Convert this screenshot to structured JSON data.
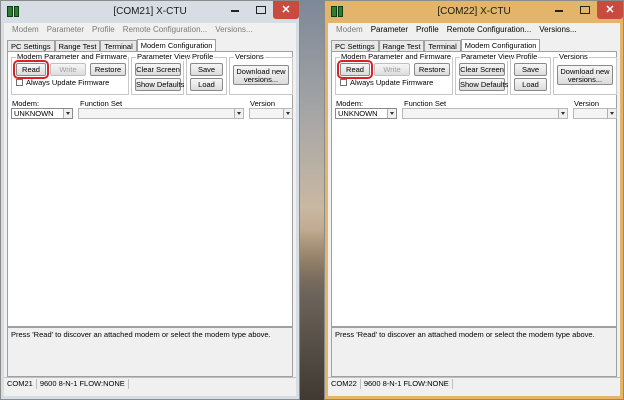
{
  "windows": [
    {
      "title": "[COM21] X-CTU",
      "menu": [
        "Modem",
        "Parameter",
        "Profile",
        "Remote Configuration...",
        "Versions..."
      ],
      "tabs": [
        "PC Settings",
        "Range Test",
        "Terminal",
        "Modem Configuration"
      ],
      "active_tab": "Modem Configuration",
      "groups": {
        "modem": "Modem Parameter and Firmware",
        "param_view": "Parameter View",
        "profile": "Profile",
        "versions": "Versions"
      },
      "buttons": {
        "read": "Read",
        "write": "Write",
        "restore": "Restore",
        "clear_screen": "Clear Screen",
        "show_defaults": "Show Defaults",
        "save": "Save",
        "load": "Load",
        "download": "Download new versions..."
      },
      "checkbox_label": "Always Update Firmware",
      "labels": {
        "modem": "Modem:",
        "function_set": "Function Set",
        "version": "Version"
      },
      "modem_value": "UNKNOWN",
      "status_message": "Press 'Read' to discover an attached modem or select the modem type above.",
      "status_bar": {
        "port": "COM21",
        "settings": "9600 8-N-1  FLOW:NONE"
      }
    },
    {
      "title": "[COM22] X-CTU",
      "menu": [
        "Modem",
        "Parameter",
        "Profile",
        "Remote Configuration...",
        "Versions..."
      ],
      "tabs": [
        "PC Settings",
        "Range Test",
        "Terminal",
        "Modem Configuration"
      ],
      "active_tab": "Modem Configuration",
      "groups": {
        "modem": "Modem Parameter and Firmware",
        "param_view": "Parameter View",
        "profile": "Profile",
        "versions": "Versions"
      },
      "buttons": {
        "read": "Read",
        "write": "Write",
        "restore": "Restore",
        "clear_screen": "Clear Screen",
        "show_defaults": "Show Defaults",
        "save": "Save",
        "load": "Load",
        "download": "Download new versions..."
      },
      "checkbox_label": "Always Update Firmware",
      "labels": {
        "modem": "Modem:",
        "function_set": "Function Set",
        "version": "Version"
      },
      "modem_value": "UNKNOWN",
      "status_message": "Press 'Read' to discover an attached modem or select the modem type above.",
      "status_bar": {
        "port": "COM22",
        "settings": "9600 8-N-1  FLOW:NONE"
      }
    }
  ],
  "colors": {
    "left_frame": "#d7dde4",
    "right_frame": "#e2b56a",
    "highlight": "#d6232a",
    "close_button": "#c94a3f"
  }
}
